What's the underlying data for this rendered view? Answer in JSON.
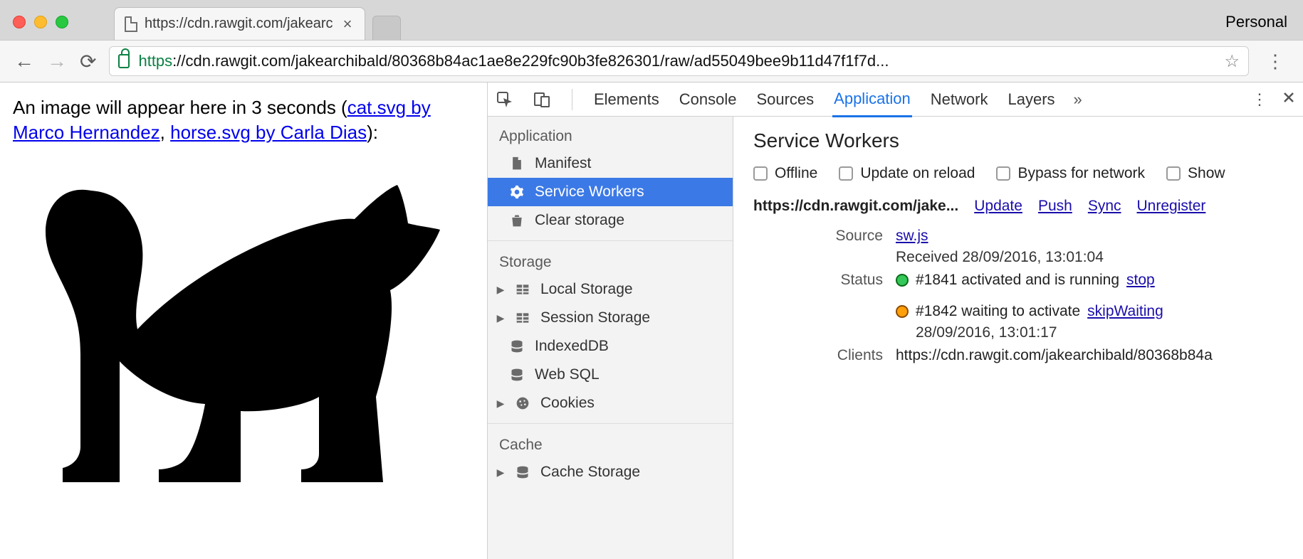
{
  "browser": {
    "profile_label": "Personal",
    "tab_title": "https://cdn.rawgit.com/jakearc",
    "url_scheme": "https",
    "url_hostpath": "://cdn.rawgit.com/jakearchibald/80368b84ac1ae8e229fc90b3fe826301/raw/ad55049bee9b11d47f1f7d..."
  },
  "page": {
    "intro_before_links": "An image will appear here in 3 seconds (",
    "link1": "cat.svg by Marco Hernandez",
    "sep": ", ",
    "link2": "horse.svg by Carla Dias",
    "intro_after_links": "):"
  },
  "devtools": {
    "tabs": [
      "Elements",
      "Console",
      "Sources",
      "Application",
      "Network",
      "Layers"
    ],
    "active_tab_index": 3,
    "more_glyph": "»",
    "sidebar": {
      "groups": [
        {
          "title": "Application",
          "items": [
            {
              "label": "Manifest",
              "icon": "file"
            },
            {
              "label": "Service Workers",
              "icon": "gear",
              "active": true
            },
            {
              "label": "Clear storage",
              "icon": "trash"
            }
          ]
        },
        {
          "title": "Storage",
          "items": [
            {
              "label": "Local Storage",
              "icon": "grid",
              "expandable": true
            },
            {
              "label": "Session Storage",
              "icon": "grid",
              "expandable": true
            },
            {
              "label": "IndexedDB",
              "icon": "db"
            },
            {
              "label": "Web SQL",
              "icon": "db"
            },
            {
              "label": "Cookies",
              "icon": "cookie",
              "expandable": true
            }
          ]
        },
        {
          "title": "Cache",
          "items": [
            {
              "label": "Cache Storage",
              "icon": "db",
              "expandable": true
            }
          ]
        }
      ]
    },
    "sw": {
      "title": "Service Workers",
      "checks": [
        "Offline",
        "Update on reload",
        "Bypass for network",
        "Show"
      ],
      "origin": "https://cdn.rawgit.com/jake...",
      "origin_actions": [
        "Update",
        "Push",
        "Sync",
        "Unregister"
      ],
      "rows": {
        "source_label": "Source",
        "source_link": "sw.js",
        "source_received": "Received 28/09/2016, 13:01:04",
        "status_label": "Status",
        "status1_text": "#1841 activated and is running",
        "status1_action": "stop",
        "status2_text": "#1842 waiting to activate",
        "status2_action": "skipWaiting",
        "status2_time": "28/09/2016, 13:01:17",
        "clients_label": "Clients",
        "clients_value": "https://cdn.rawgit.com/jakearchibald/80368b84a"
      }
    }
  }
}
